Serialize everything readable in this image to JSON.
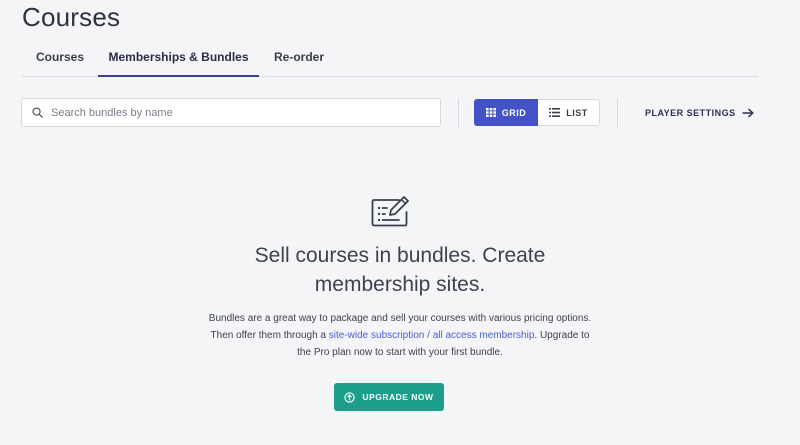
{
  "header": {
    "title": "Courses"
  },
  "tabs": [
    {
      "label": "Courses",
      "active": false
    },
    {
      "label": "Memberships & Bundles",
      "active": true
    },
    {
      "label": "Re-order",
      "active": false
    }
  ],
  "toolbar": {
    "search_placeholder": "Search bundles by name",
    "search_value": "",
    "view_toggle": {
      "selected": "GRID",
      "grid_label": "GRID",
      "list_label": "LIST"
    },
    "player_settings_label": "PLAYER SETTINGS"
  },
  "empty_state": {
    "icon": "edit-list-icon",
    "heading_line1": "Sell courses in bundles. Create",
    "heading_line2": "membership sites.",
    "description_line1": "Bundles are a great way to package and sell your courses with various pricing options.",
    "description_line2_pre": "Then offer them through a ",
    "description_link": "site-wide subscription / all access membership",
    "description_line2_post": ". Upgrade to",
    "description_line3": "the Pro plan now to start with your first bundle.",
    "cta_label": "UPGRADE NOW"
  },
  "colors": {
    "background": "#f4f5f7",
    "primary": "#4353c7",
    "cta": "#1c9e8a",
    "link": "#4b5dd1",
    "active_tab_underline": "#3a3f8f"
  }
}
